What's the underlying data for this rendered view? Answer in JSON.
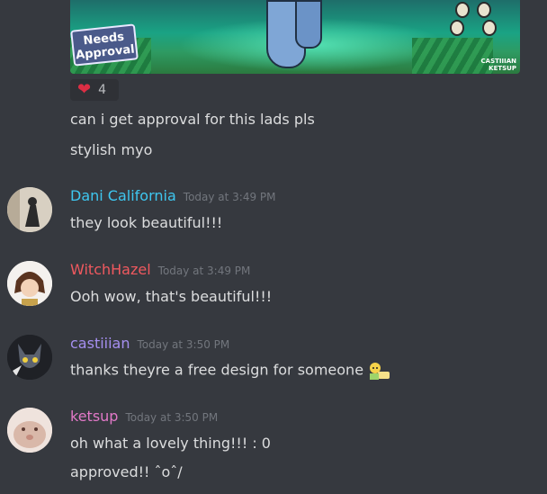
{
  "embed": {
    "badge_text": "Needs Approval",
    "credit_small": "CASTIIIAN",
    "credit_name": "KETSUP"
  },
  "reaction": {
    "emoji": "heart-icon",
    "count": "4"
  },
  "continued_lines": [
    "can i get approval for this lads pls",
    "stylish myo"
  ],
  "messages": [
    {
      "author": "Dani California",
      "author_color": "#3ec7f0",
      "timestamp": "Today at 3:49 PM",
      "lines": [
        "they look beautiful!!!"
      ]
    },
    {
      "author": "WitchHazel",
      "author_color": "#f0595f",
      "timestamp": "Today at 3:49 PM",
      "lines": [
        "Ooh wow, that's beautiful!!!"
      ]
    },
    {
      "author": "castiiian",
      "author_color": "#a58ff0",
      "timestamp": "Today at 3:50 PM",
      "lines": [
        "thanks theyre a free design for someone"
      ]
    },
    {
      "author": "ketsup",
      "author_color": "#e279c8",
      "timestamp": "Today at 3:50 PM",
      "lines": [
        "oh what a lovely thing!!! : 0",
        "approved!! ˆoˆ/"
      ]
    }
  ]
}
